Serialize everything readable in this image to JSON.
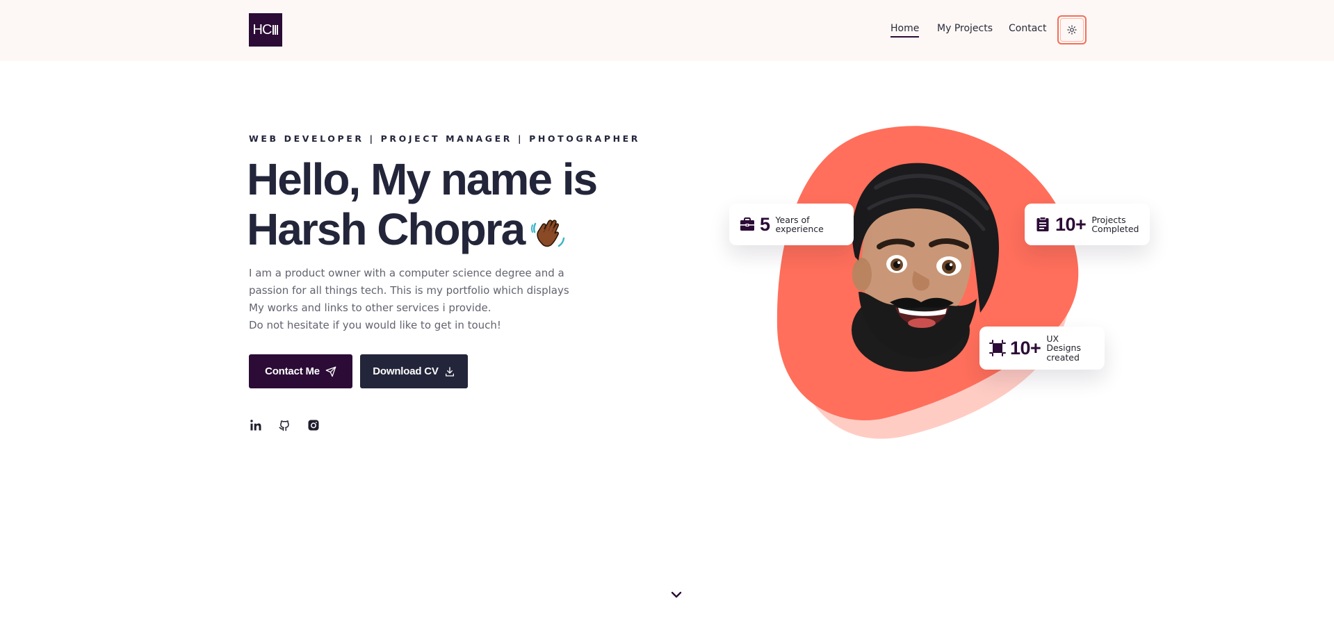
{
  "header": {
    "logo_text": "HC",
    "nav": [
      {
        "label": "Home",
        "active": true
      },
      {
        "label": "My Projects"
      },
      {
        "label": "Contact"
      }
    ],
    "theme_toggle_icon": "sun-icon"
  },
  "hero": {
    "tagline": "WEB DEVELOPER | PROJECT MANAGER | PHOTOGRAPHER",
    "title_line1": "Hello, My name is",
    "title_line2": "Harsh Chopra",
    "wave_icon": "waving-hand-icon",
    "intro_lines": [
      "I am a product owner with a computer science degree and a",
      "passion for all things tech. This is my portfolio which displays",
      "My works and links to other services i provide.",
      "Do not hesitate if you would like to get in touch!"
    ],
    "buttons": {
      "contact": {
        "label": "Contact Me",
        "icon": "send-icon"
      },
      "cv": {
        "label": "Download CV",
        "icon": "download-icon"
      }
    },
    "social": [
      "linkedin-icon",
      "github-icon",
      "instagram-icon"
    ]
  },
  "stats": [
    {
      "value": "5",
      "label": "Years of experience",
      "icon": "briefcase-icon"
    },
    {
      "value": "10+",
      "label": "Projects Completed",
      "icon": "clipboard-icon"
    },
    {
      "value": "10+",
      "label": "UX Designs created",
      "icon": "frame-icon"
    }
  ],
  "colors": {
    "primary": "#2c0b36",
    "dark": "#23253a",
    "accent": "#ff6f5b",
    "accent_light": "#ffccc4",
    "header_bg": "#fdf8f5"
  }
}
